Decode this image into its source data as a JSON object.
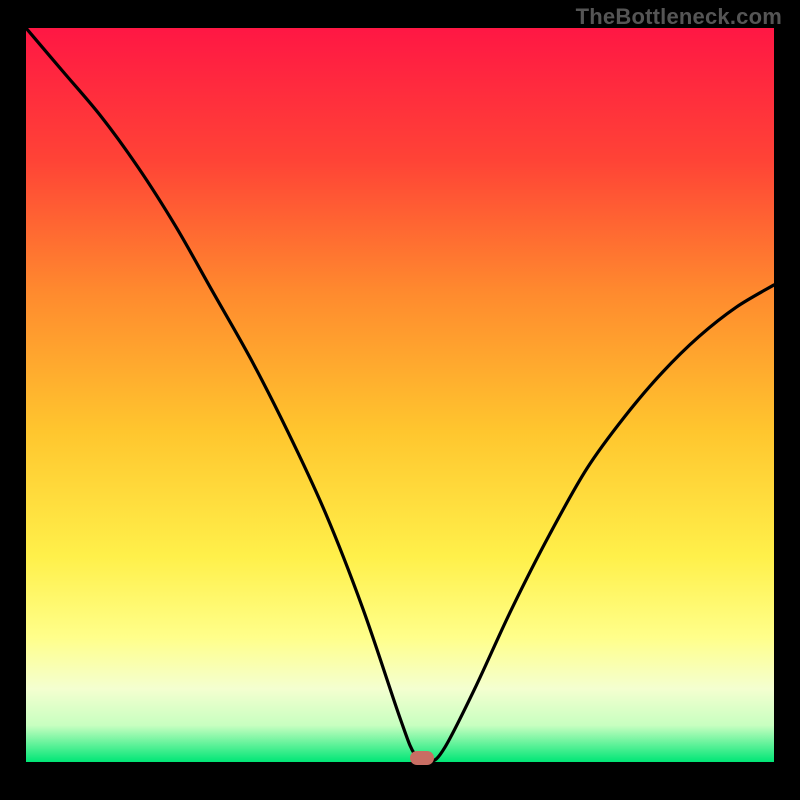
{
  "watermark": "TheBottleneck.com",
  "chart_data": {
    "type": "line",
    "title": "",
    "xlabel": "",
    "ylabel": "",
    "xlim": [
      0,
      100
    ],
    "ylim": [
      0,
      100
    ],
    "grid": false,
    "legend": false,
    "background_gradient": [
      "#ff1744",
      "#ff6b3a",
      "#ffa733",
      "#ffd633",
      "#ffff66",
      "#f5ffcc",
      "#b6ffb3",
      "#00e676"
    ],
    "series": [
      {
        "name": "bottleneck-curve",
        "x": [
          0,
          5,
          10,
          15,
          20,
          25,
          30,
          35,
          40,
          45,
          50,
          52,
          54,
          56,
          60,
          65,
          70,
          75,
          80,
          85,
          90,
          95,
          100
        ],
        "y": [
          100,
          94,
          88,
          81,
          73,
          64,
          55,
          45,
          34,
          21,
          6,
          1,
          0,
          2,
          10,
          21,
          31,
          40,
          47,
          53,
          58,
          62,
          65
        ]
      }
    ],
    "optimum_point": {
      "x": 53,
      "y": 0
    }
  }
}
